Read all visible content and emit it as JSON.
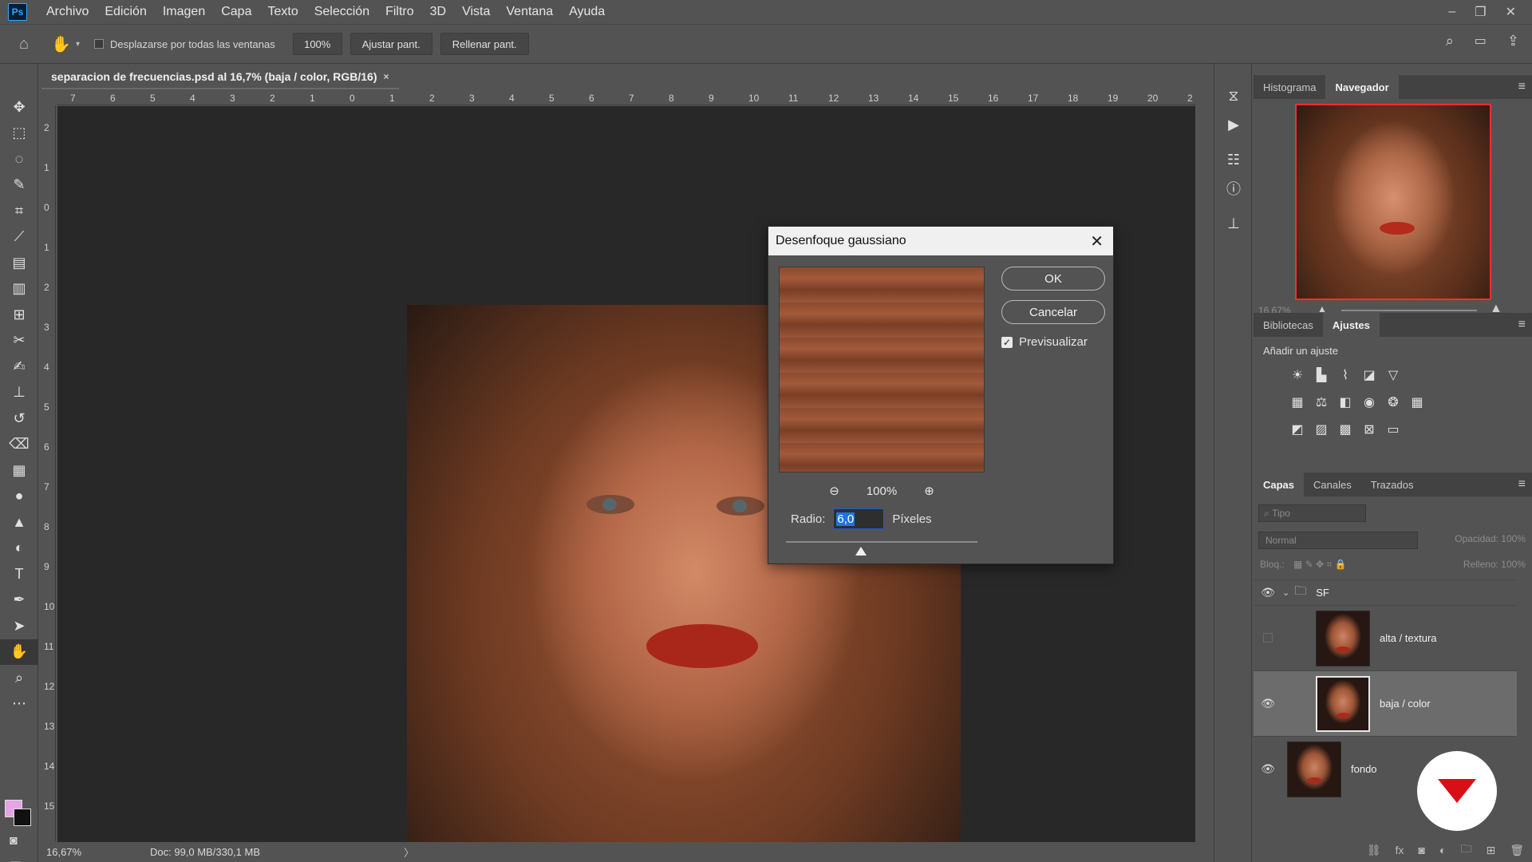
{
  "menubar": {
    "logo": "Ps",
    "items": [
      "Archivo",
      "Edición",
      "Imagen",
      "Capa",
      "Texto",
      "Selección",
      "Filtro",
      "3D",
      "Vista",
      "Ventana",
      "Ayuda"
    ],
    "window_controls": [
      "–",
      "❐",
      "✕"
    ]
  },
  "options": {
    "scroll_all_label": "Desplazarse por todas las ventanas",
    "zoom_value": "100%",
    "fit_screen_label": "Ajustar pant.",
    "fill_screen_label": "Rellenar pant."
  },
  "document": {
    "tab_title": "separacion de frecuencias.psd al 16,7% (baja / color, RGB/16)",
    "ruler_h": [
      "7",
      "6",
      "5",
      "4",
      "3",
      "2",
      "1",
      "0",
      "1",
      "2",
      "3",
      "4",
      "5",
      "6",
      "7",
      "8",
      "9",
      "10",
      "11",
      "12",
      "13",
      "14",
      "15",
      "16",
      "17",
      "18",
      "19",
      "20",
      "2"
    ],
    "ruler_v": [
      "2",
      "1",
      "0",
      "1",
      "2",
      "3",
      "4",
      "5",
      "6",
      "7",
      "8",
      "9",
      "10",
      "11",
      "12",
      "13",
      "14",
      "15"
    ],
    "zoom": "16,67%",
    "doc_info": "Doc: 99,0 MB/330,1 MB"
  },
  "dialog": {
    "title": "Desenfoque gaussiano",
    "ok_label": "OK",
    "cancel_label": "Cancelar",
    "preview_label": "Previsualizar",
    "preview_checked": true,
    "zoom_label": "100%",
    "radius_label": "Radio:",
    "radius_value": "6,0",
    "radius_unit": "Píxeles"
  },
  "navigator": {
    "tabs": [
      "Histograma",
      "Navegador"
    ],
    "active_tab": "Navegador",
    "zoom": "16,67%"
  },
  "adjustments": {
    "tabs": [
      "Bibliotecas",
      "Ajustes"
    ],
    "active_tab": "Ajustes",
    "add_label": "Añadir un ajuste"
  },
  "layers": {
    "tabs": [
      "Capas",
      "Canales",
      "Trazados"
    ],
    "active_tab": "Capas",
    "search_placeholder": "Tipo",
    "blend_mode": "Normal",
    "opacity_label": "Opacidad:",
    "opacity_value": "100%",
    "lock_label": "Bloq.:",
    "fill_label": "Relleno:",
    "fill_value": "100%",
    "items": [
      {
        "name": "SF",
        "type": "group",
        "visible": true
      },
      {
        "name": "alta / textura",
        "type": "layer",
        "visible": false
      },
      {
        "name": "baja / color",
        "type": "layer",
        "visible": true,
        "selected": true
      },
      {
        "name": "fondo",
        "type": "layer",
        "visible": true
      }
    ]
  },
  "colors": {
    "accent_blue": "#31a8ff",
    "navigator_frame": "#ff2d2d",
    "foreground": "#e6a3e6",
    "background": "#111111",
    "brand_red": "#d90f17"
  }
}
